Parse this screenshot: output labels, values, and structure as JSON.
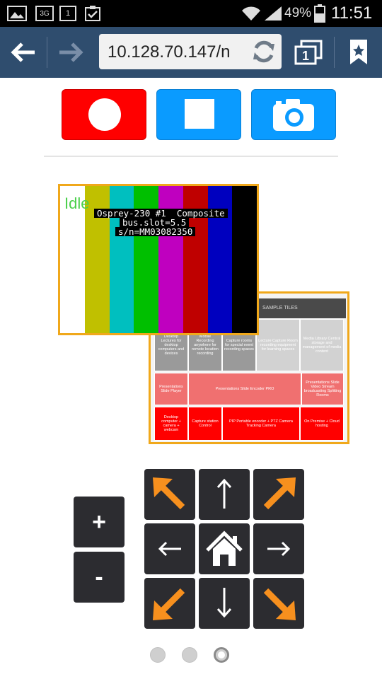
{
  "status_bar": {
    "network": "3G",
    "notification_count": "1",
    "battery": "49%",
    "time": "11:51"
  },
  "browser": {
    "url": "10.128.70.147/n",
    "tab_count": "1"
  },
  "preview": {
    "state": "Idle",
    "overlay_lines": [
      "Osprey-230 #1  Composite",
      "bus.slot=5.5",
      "s/n=MM03082350"
    ],
    "bar_colors": [
      "#ffffff",
      "#c0c000",
      "#00bfbf",
      "#00bf00",
      "#bf00bf",
      "#bf0000",
      "#0000bf",
      "#000000"
    ]
  },
  "slide": {
    "header": "SAMPLE TILES",
    "rows": [
      [
        "Desktop Lectures for desktop computers and devices",
        "Mobile Recording anywhere for remote location recording",
        "Capture rooms for special event recording spaces",
        "Lecture Capture Room recording equipment for learning spaces",
        "Media Library Central storage and management of media content"
      ],
      [
        "Presentations Slide Player",
        "Presentations Slide Encoder PRO",
        "Presentations Slide Video Stream broadcasting Splitting Rooms"
      ],
      [
        "Desktop computer + camera + webcam",
        "Capture station Control",
        "PIP Portable encoder + PTZ Camera Tracking Camera",
        "On Premise + Cloud hosting"
      ]
    ]
  },
  "controls": {
    "zoom_in": "+",
    "zoom_out": "-"
  },
  "pager": {
    "count": 3,
    "active": 3
  },
  "colors": {
    "record": "#ff0000",
    "button_blue": "#0a9bff",
    "toolbar": "#2f4d6e",
    "pad": "#2c2c30",
    "arrow_orange": "#f7901e",
    "frame_orange": "#f0a81b"
  }
}
